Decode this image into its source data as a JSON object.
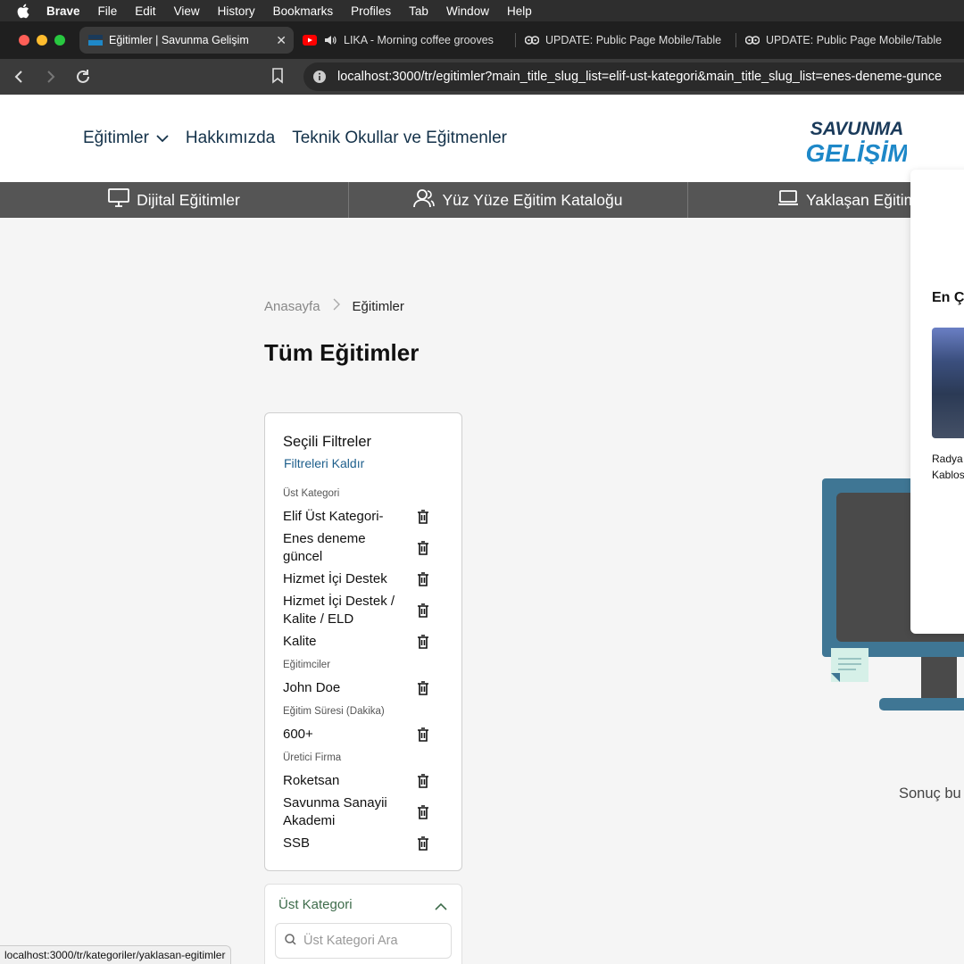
{
  "menubar": {
    "app": "Brave",
    "items": [
      "File",
      "Edit",
      "View",
      "History",
      "Bookmarks",
      "Profiles",
      "Tab",
      "Window",
      "Help"
    ]
  },
  "tabs": [
    {
      "title": "Eğitimler | Savunma Gelişim",
      "active": true,
      "close": "✕"
    },
    {
      "title": "LIKA - Morning coffee grooves",
      "active": false
    },
    {
      "title": "UPDATE: Public Page Mobile/Table",
      "active": false
    },
    {
      "title": "UPDATE: Public Page Mobile/Table",
      "active": false
    }
  ],
  "address": {
    "url": "localhost:3000/tr/egitimler?main_title_slug_list=elif-ust-kategori&main_title_slug_list=enes-deneme-gunce"
  },
  "topnav": {
    "links": [
      "Eğitimler",
      "Hakkımızda",
      "Teknik Okullar ve Eğitmenler"
    ],
    "logo_top": "SAVUNMA",
    "logo_bottom": "GELİŞİM"
  },
  "catbar": {
    "items": [
      "Dijital Eğitimler",
      "Yüz Yüze Eğitim Kataloğu",
      "Yaklaşan Eğitim"
    ]
  },
  "breadcrumb": {
    "home": "Anasayfa",
    "sep": ">",
    "current": "Eğitimler"
  },
  "page_title": "Tüm Eğitimler",
  "filters": {
    "title": "Seçili Filtreler",
    "clear": "Filtreleri Kaldır",
    "groups": [
      {
        "label": "Üst Kategori",
        "items": [
          "Elif Üst Kategori-",
          "Enes deneme güncel",
          "Hizmet İçi Destek",
          "Hizmet İçi Destek / Kalite / ELD",
          "Kalite"
        ]
      },
      {
        "label": "Eğitimciler",
        "items": [
          "John Doe"
        ]
      },
      {
        "label": "Eğitim Süresi (Dakika)",
        "items": [
          "600+"
        ]
      },
      {
        "label": "Üretici Firma",
        "items": [
          "Roketsan",
          "Savunma Sanayii Akademi",
          "SSB"
        ]
      }
    ]
  },
  "category_panel": {
    "title": "Üst Kategori",
    "search_placeholder": "Üst Kategori Ara"
  },
  "popup": {
    "heading": "En Ç",
    "text_line1": "Radya",
    "text_line2": "Kablos"
  },
  "results_text": "Sonuç bu",
  "status_bar": "localhost:3000/tr/kategoriler/yaklasan-egitimler",
  "colors": {
    "accent": "#1e5f8c",
    "nav_text": "#14324a",
    "catbar": "#555555",
    "monitor": "#3f7694"
  }
}
